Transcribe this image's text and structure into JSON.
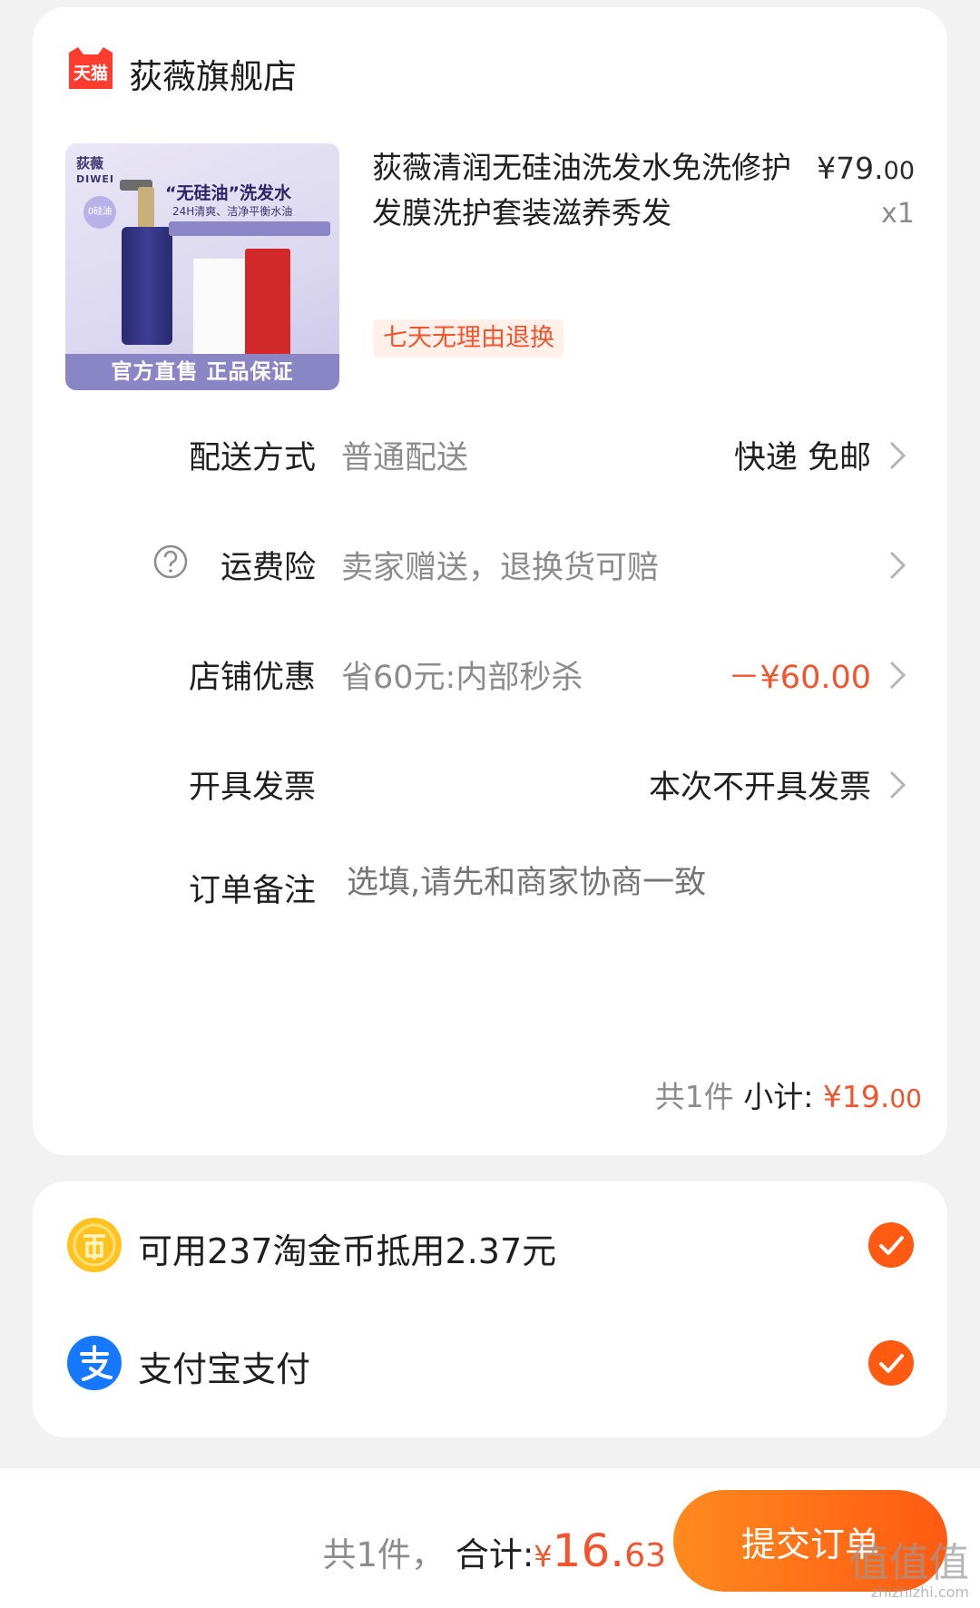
{
  "store": {
    "platform_badge": "天猫",
    "name": "荻薇旗舰店"
  },
  "product": {
    "title": "荻薇清润无硅油洗发水免洗修护发膜洗护套装滋养秀发",
    "price_int": "¥79.",
    "price_dec": "00",
    "quantity": "x1",
    "return_tag": "七天无理由退换",
    "image": {
      "brand": "荻薇",
      "brand_en": "DIWEI",
      "headline": "“无硅油”洗发水",
      "subline": "24H清爽、洁净平衡水油",
      "badge": "0硅油",
      "banner": "官方直售  正品保证"
    }
  },
  "rows": {
    "delivery": {
      "label": "配送方式",
      "value": "普通配送",
      "right": "快递 免邮"
    },
    "insurance": {
      "label": "运费险",
      "value": "卖家赠送，退换货可赔"
    },
    "store_discount": {
      "label": "店铺优惠",
      "value": "省60元:内部秒杀",
      "right": "－¥60.00"
    },
    "invoice": {
      "label": "开具发票",
      "right": "本次不开具发票"
    },
    "note": {
      "label": "订单备注",
      "placeholder": "选填,请先和商家协商一致"
    }
  },
  "subtotal": {
    "count": "共1件",
    "label": "小计:",
    "amount_int": "¥19.",
    "amount_dec": "00"
  },
  "payment": {
    "coins": {
      "label": "可用237淘金币抵用2.37元",
      "checked": true
    },
    "alipay": {
      "label": "支付宝支付",
      "checked": true
    }
  },
  "bottom": {
    "count": "共1件，",
    "total_label": "合计:",
    "yen": "¥",
    "total_int": "16.",
    "total_dec": "63",
    "submit_label": "提交订单"
  },
  "watermark": {
    "text": "值值值",
    "url": "zhizhizhi.com"
  },
  "colors": {
    "accent": "#f2542d",
    "button_gradient_start": "#ff8a1e",
    "button_gradient_end": "#ff5a12",
    "tmall_red": "#ff3d2e",
    "alipay_blue": "#1677ff",
    "coin_gold": "#ffc21e"
  }
}
